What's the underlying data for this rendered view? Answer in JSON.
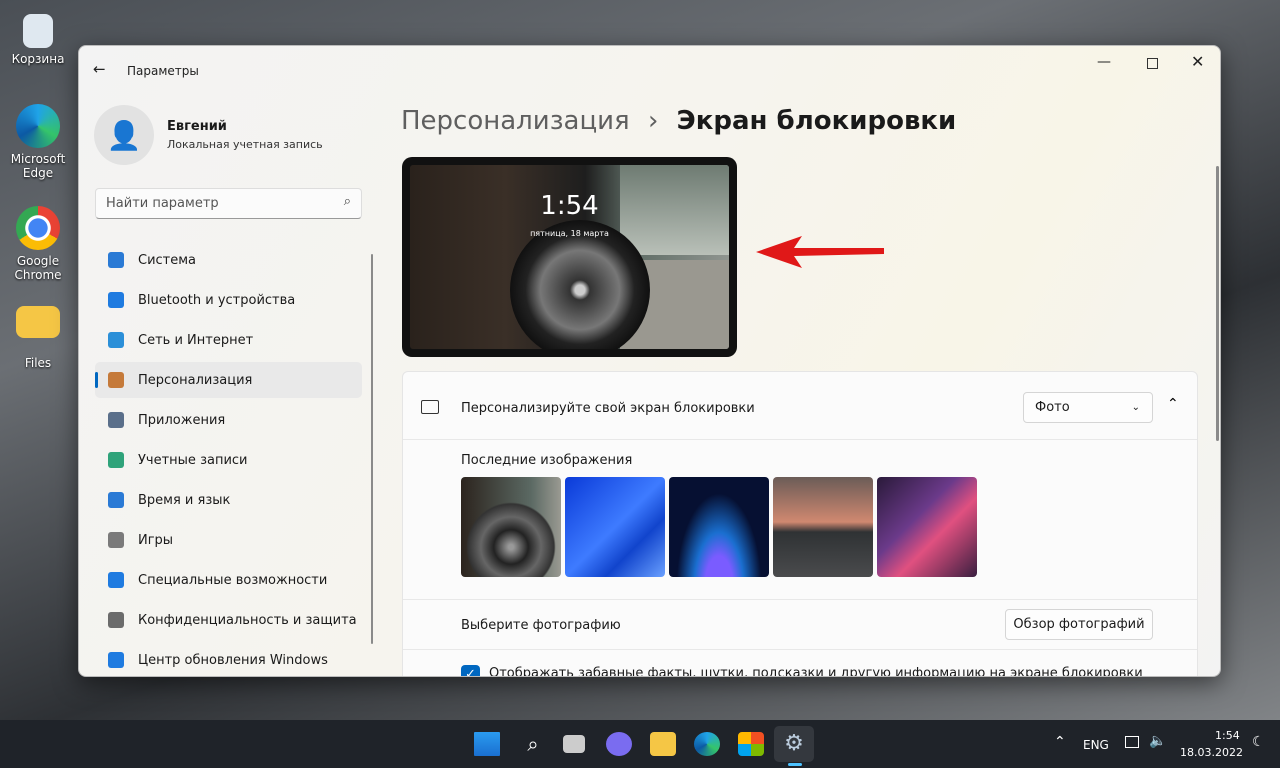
{
  "desktop": {
    "icons": [
      {
        "label": "Корзина"
      },
      {
        "label": "Microsoft Edge"
      },
      {
        "label": "Google Chrome"
      },
      {
        "label": "Files"
      }
    ]
  },
  "window": {
    "title": "Параметры",
    "back_icon": "arrow-left-icon",
    "controls": [
      "minimize",
      "maximize",
      "close"
    ]
  },
  "user": {
    "name": "Евгений",
    "account": "Локальная учетная запись"
  },
  "search": {
    "placeholder": "Найти параметр",
    "icon": "search-icon"
  },
  "sidebar": {
    "items": [
      {
        "label": "Система",
        "icon": "monitor-icon",
        "color": "#2a7ad5"
      },
      {
        "label": "Bluetooth и устройства",
        "icon": "bluetooth-icon",
        "color": "#1f7be0"
      },
      {
        "label": "Сеть и Интернет",
        "icon": "wifi-icon",
        "color": "#2b8fd8"
      },
      {
        "label": "Персонализация",
        "icon": "brush-icon",
        "color": "#c57a3a",
        "selected": true
      },
      {
        "label": "Приложения",
        "icon": "apps-icon",
        "color": "#5a6f8a"
      },
      {
        "label": "Учетные записи",
        "icon": "person-icon",
        "color": "#2fa37a"
      },
      {
        "label": "Время и язык",
        "icon": "globe-clock-icon",
        "color": "#2a7ad5"
      },
      {
        "label": "Игры",
        "icon": "gamepad-icon",
        "color": "#7a7a7a"
      },
      {
        "label": "Специальные возможности",
        "icon": "accessibility-icon",
        "color": "#1f7be0"
      },
      {
        "label": "Конфиденциальность и защита",
        "icon": "shield-icon",
        "color": "#6b6b6b"
      },
      {
        "label": "Центр обновления Windows",
        "icon": "update-icon",
        "color": "#1f7be0"
      }
    ]
  },
  "breadcrumb": {
    "parent": "Персонализация",
    "separator": "›",
    "current": "Экран блокировки"
  },
  "preview": {
    "time": "1:54",
    "date": "пятница, 18 марта"
  },
  "accent": "#0067c0",
  "lock_card": {
    "label": "Персонализируйте свой экран блокировки",
    "dropdown_value": "Фото",
    "recent_label": "Последние изображения",
    "thumbnails": [
      "bmw-wheel",
      "blue-bloom",
      "dark-bloom",
      "sunset-lake",
      "purple-ribbon"
    ]
  },
  "choose_row": {
    "label": "Выберите фотографию",
    "button": "Обзор фотографий"
  },
  "facts_row": {
    "label": "Отображать забавные факты, шутки, подсказки и другую информацию на экране блокировки",
    "checked": true
  },
  "taskbar": {
    "lang": "ENG",
    "time": "1:54",
    "date": "18.03.2022"
  }
}
